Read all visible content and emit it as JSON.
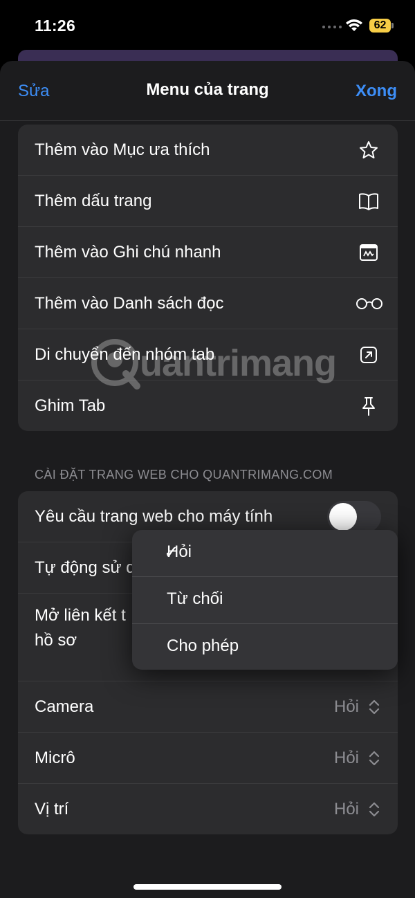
{
  "status_bar": {
    "time": "11:26",
    "battery": "62"
  },
  "nav": {
    "left": "Sửa",
    "title": "Menu của trang",
    "right": "Xong"
  },
  "menu_items": [
    {
      "label": "Thêm vào Mục ưa thích",
      "icon": "star-icon"
    },
    {
      "label": "Thêm dấu trang",
      "icon": "book-icon"
    },
    {
      "label": "Thêm vào Ghi chú nhanh",
      "icon": "quick-note-icon"
    },
    {
      "label": "Thêm vào Danh sách đọc",
      "icon": "glasses-icon"
    },
    {
      "label": "Di chuyển đến nhóm tab",
      "icon": "move-to-tab-group-icon"
    },
    {
      "label": "Ghim Tab",
      "icon": "pin-icon"
    }
  ],
  "settings": {
    "section_header": "CÀI ĐẶT TRANG WEB CHO QUANTRIMANG.COM",
    "desktop_site": {
      "label": "Yêu cầu trang web cho máy tính",
      "enabled": false
    },
    "reader": {
      "label": "Tự động sử d"
    },
    "open_links": {
      "label_line1": "Mở liên kết t",
      "label_line2": "hồ sơ"
    },
    "camera": {
      "label": "Camera",
      "value": "Hỏi"
    },
    "microphone": {
      "label": "Micrô",
      "value": "Hỏi"
    },
    "location": {
      "label": "Vị trí",
      "value": "Hỏi"
    }
  },
  "popover": {
    "check": "✓",
    "options": [
      "Hỏi",
      "Từ chối",
      "Cho phép"
    ],
    "selected": "Hỏi"
  },
  "watermark": "uantrimang"
}
